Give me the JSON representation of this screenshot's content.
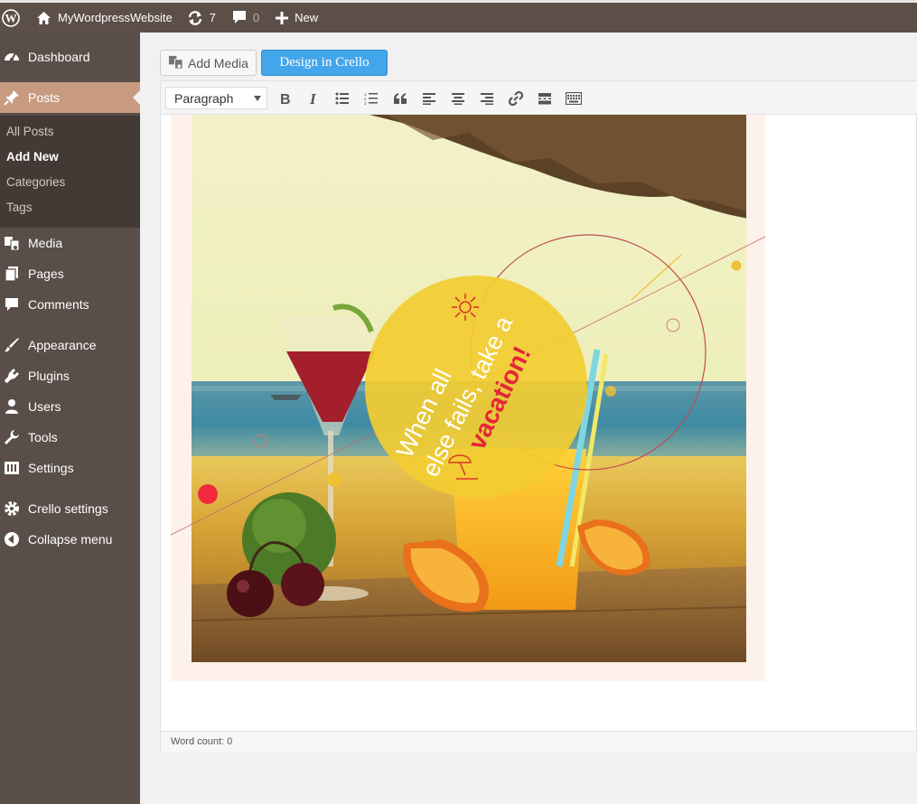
{
  "admin_bar": {
    "site_name": "MyWordpressWebsite",
    "updates_count": "7",
    "comments_count": "0",
    "new_label": "New"
  },
  "sidebar": {
    "items": [
      {
        "label": "Dashboard",
        "icon": "dashboard-icon"
      },
      {
        "label": "Posts",
        "icon": "pin-icon"
      },
      {
        "label": "Media",
        "icon": "media-icon"
      },
      {
        "label": "Pages",
        "icon": "pages-icon"
      },
      {
        "label": "Comments",
        "icon": "comments-icon"
      },
      {
        "label": "Appearance",
        "icon": "brush-icon"
      },
      {
        "label": "Plugins",
        "icon": "plugin-icon"
      },
      {
        "label": "Users",
        "icon": "user-icon"
      },
      {
        "label": "Tools",
        "icon": "wrench-icon"
      },
      {
        "label": "Settings",
        "icon": "settings-icon"
      },
      {
        "label": "Crello settings",
        "icon": "gear-icon"
      },
      {
        "label": "Collapse menu",
        "icon": "collapse-icon"
      }
    ],
    "submenu": [
      "All Posts",
      "Add New",
      "Categories",
      "Tags"
    ]
  },
  "editor": {
    "add_media_label": "Add Media",
    "crello_label": "Design in Crello",
    "format_value": "Paragraph",
    "word_count": "Word count: 0"
  },
  "image": {
    "line1": "When all",
    "line2": "else fails, take a",
    "line3": "vacation!"
  },
  "colors": {
    "admin_bar": "#5c4f48",
    "sidebar": "#594e48",
    "active": "#c89b80",
    "crello_blue": "#43a6ea"
  }
}
